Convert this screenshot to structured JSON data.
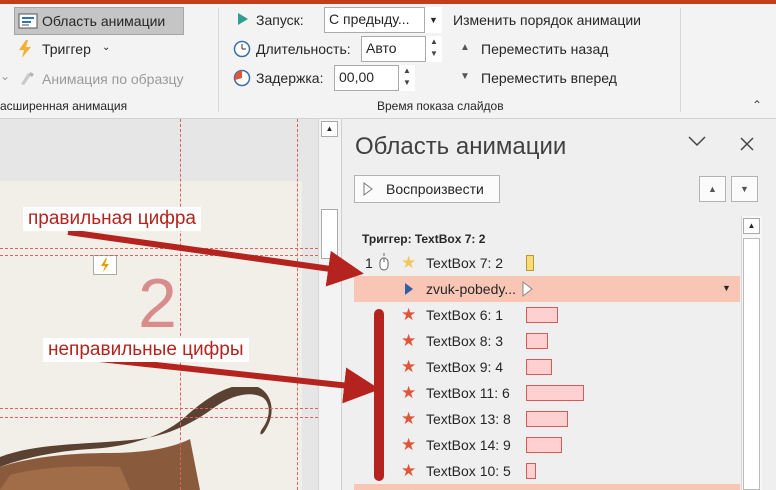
{
  "ribbon": {
    "animation_pane_button": "Область анимации",
    "trigger_button": "Триггер",
    "animation_painter": "Анимация по образцу",
    "group_advanced": "асширенная анимация",
    "start_label": "Запуск:",
    "start_value": "С предыду...",
    "duration_label": "Длительность:",
    "duration_value": "Авто",
    "delay_label": "Задержка:",
    "delay_value": "00,00",
    "group_timing": "Время показа слайдов",
    "reorder_title": "Изменить порядок анимации",
    "move_earlier": "Переместить назад",
    "move_later": "Переместить вперед"
  },
  "slide": {
    "number_text": "2"
  },
  "annotations": {
    "correct": "правильная цифра",
    "wrong": "неправильные цифры"
  },
  "pane": {
    "title": "Область анимации",
    "play_button": "Воспроизвести",
    "trigger_header": "Триггер: TextBox 7: 2",
    "items": [
      {
        "num": "1",
        "label": "TextBox 7: 2",
        "effect": "star-outline",
        "bar_color": "#f5d36b",
        "bar_border": "#b89a30",
        "bar_left": 0,
        "bar_width": 0.14
      },
      {
        "num": "",
        "label": "zvuk-pobedy...",
        "effect": "play",
        "selected": true
      },
      {
        "num": "",
        "label": "TextBox 6: 1",
        "effect": "star",
        "bar_left": 0,
        "bar_width": 0.55
      },
      {
        "num": "",
        "label": "TextBox 8: 3",
        "effect": "star",
        "bar_left": 0,
        "bar_width": 0.38
      },
      {
        "num": "",
        "label": "TextBox 9: 4",
        "effect": "star",
        "bar_left": 0,
        "bar_width": 0.45
      },
      {
        "num": "",
        "label": "TextBox 11: 6",
        "effect": "star",
        "bar_left": 0,
        "bar_width": 1.0
      },
      {
        "num": "",
        "label": "TextBox 13: 8",
        "effect": "star",
        "bar_left": 0,
        "bar_width": 0.72
      },
      {
        "num": "",
        "label": "TextBox 14: 9",
        "effect": "star",
        "bar_left": 0,
        "bar_width": 0.62
      },
      {
        "num": "",
        "label": "TextBox 10: 5",
        "effect": "star",
        "bar_left": 0,
        "bar_width": 0.17
      }
    ]
  },
  "colors": {
    "accent": "#c43e1c",
    "selected_row": "#f9c6b5",
    "annotation_red": "#b4231e",
    "star_red": "#e0563a"
  }
}
